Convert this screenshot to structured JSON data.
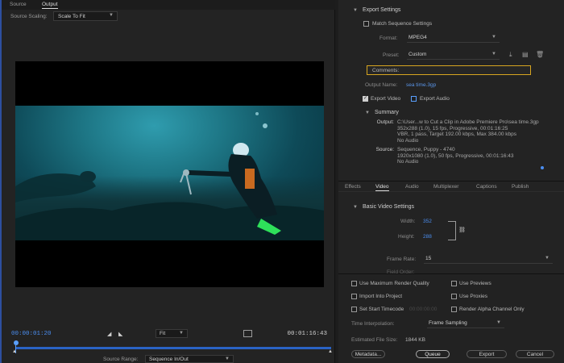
{
  "source_tabs": [
    "Source",
    "Output"
  ],
  "source_scaling": {
    "label": "Source Scaling:",
    "value": "Scale To Fit"
  },
  "timeline": {
    "timecode_in": "00:00:01:20",
    "timecode_out": "00:01:16:43",
    "zoom": "Fit",
    "source_range_label": "Source Range:",
    "source_range_value": "Sequence In/Out"
  },
  "export_settings": {
    "title": "Export Settings",
    "match_sequence": "Match Sequence Settings",
    "format_label": "Format:",
    "format_value": "MPEG4",
    "preset_label": "Preset:",
    "preset_value": "Custom",
    "comments_label": "Comments:",
    "output_name_label": "Output Name:",
    "output_name_value": "sea time.3gp",
    "export_video": "Export Video",
    "export_audio": "Export Audio"
  },
  "summary": {
    "title": "Summary",
    "output_key": "Output:",
    "output_lines": [
      "C:\\User...w to Cut a Clip in Adobe Premiere Pro\\sea time.3gp",
      "352x288 (1.0), 15 fps, Progressive, 00:01:16:25",
      "VBR, 1 pass, Target 192.00 kbps, Max 384.00 kbps",
      "No Audio"
    ],
    "source_key": "Source:",
    "source_lines": [
      "Sequence, Puppy - 4740",
      "1920x1080 (1.0), 50 fps, Progressive, 00:01:16:43",
      "No Audio"
    ]
  },
  "right_tabs": [
    "Effects",
    "Video",
    "Audio",
    "Multiplexer",
    "Captions",
    "Publish"
  ],
  "basic_video": {
    "title": "Basic Video Settings",
    "width_label": "Width:",
    "width_value": "352",
    "height_label": "Height:",
    "height_value": "288",
    "frame_rate_label": "Frame Rate:",
    "frame_rate_value": "15",
    "field_order_label": "Field Order:"
  },
  "options": {
    "max_render": "Use Maximum Render Quality",
    "use_previews": "Use Previews",
    "import_project": "Import Into Project",
    "use_proxies": "Use Proxies",
    "set_start_tc": "Set Start Timecode",
    "start_tc_value": "00:00:00:00",
    "render_alpha": "Render Alpha Channel Only",
    "time_interp_label": "Time Interpolation:",
    "time_interp_value": "Frame Sampling",
    "file_size_label": "Estimated File Size:",
    "file_size_value": "1844 KB"
  },
  "buttons": {
    "metadata": "Metadata...",
    "queue": "Queue",
    "export": "Export",
    "cancel": "Cancel"
  }
}
